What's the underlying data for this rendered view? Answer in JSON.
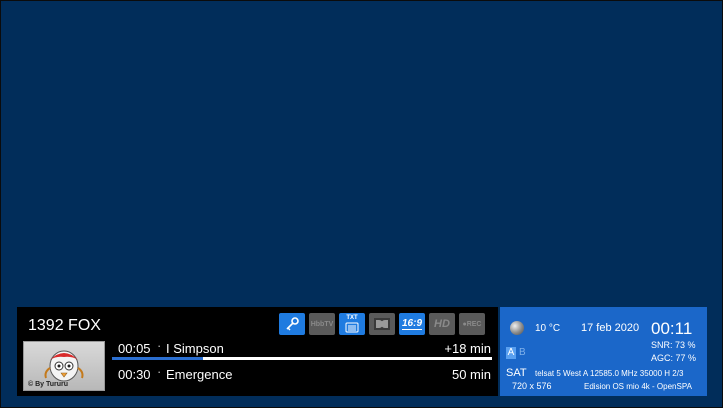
{
  "channel": {
    "name": "1392 FOX"
  },
  "status_icons": [
    {
      "name": "key-icon",
      "label": "",
      "active": true
    },
    {
      "name": "hbbtv-icon",
      "label": "HbbTV",
      "active": false
    },
    {
      "name": "teletext-icon",
      "label": "TXT",
      "active": true
    },
    {
      "name": "dolby-icon",
      "label": "",
      "active": false
    },
    {
      "name": "aspect-16-9-icon",
      "label": "16:9",
      "active": true
    },
    {
      "name": "hd-icon",
      "label": "HD",
      "active": false
    },
    {
      "name": "rec-icon",
      "label": "●REC",
      "active": false
    }
  ],
  "logo": {
    "caption": "© By Tururu"
  },
  "epg": {
    "now": {
      "time": "00:05",
      "separator": "·",
      "title": "I Simpson",
      "remaining": "+18 min",
      "progress": 0.24
    },
    "next": {
      "time": "00:30",
      "separator": "·",
      "title": "Emergence",
      "duration": "50 min"
    }
  },
  "info": {
    "temperature": "10 °C",
    "date": "17 feb 2020",
    "clock": "00:11",
    "snr": "SNR:  73 %",
    "agc": "AGC:  77 %",
    "tuner_a": "A",
    "tuner_b": "B",
    "type": "SAT",
    "transponder": "telsat 5 West A 12585.0 MHz 35000 H 2/3",
    "resolution": "720 x 576",
    "device": "Edision OS mio 4k - OpenSPA"
  },
  "colors": {
    "background": "#012d5a",
    "bar": "#000000",
    "panel": "#1b67c9",
    "active_icon": "#1f7be0",
    "inactive_icon": "#5a5a5a"
  }
}
